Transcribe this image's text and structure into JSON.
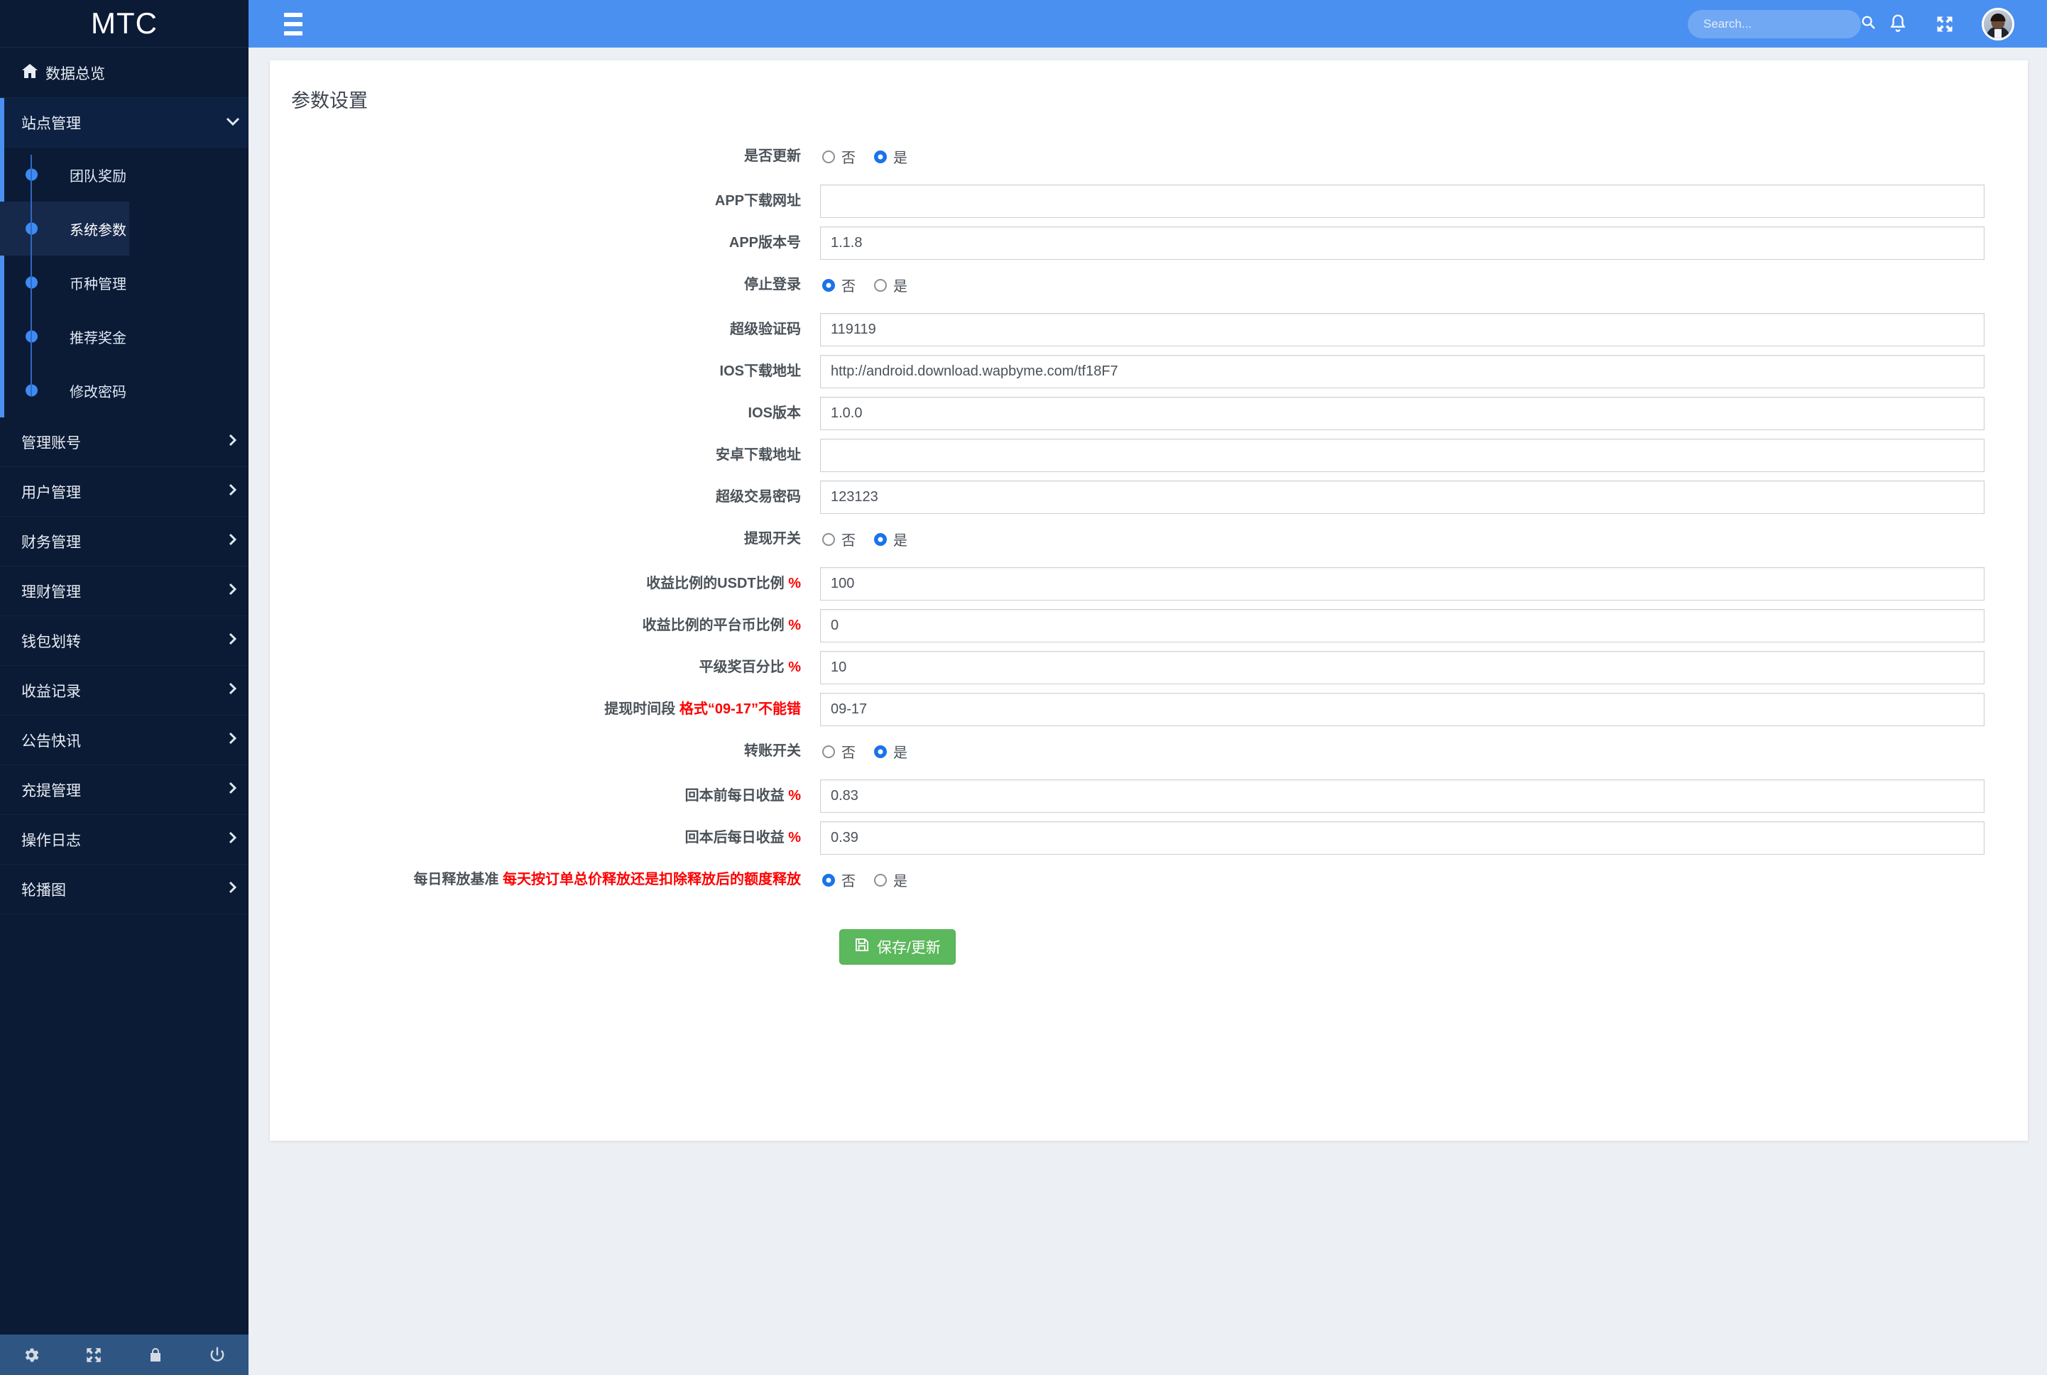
{
  "brand": {
    "title": "MTC"
  },
  "header": {
    "search": {
      "placeholder": "Search...",
      "value": ""
    },
    "icons": {
      "menu": "hamburger-icon",
      "search": "search-icon",
      "bell": "bell-icon",
      "fullscreen": "fullscreen-icon",
      "avatar": "user-avatar"
    }
  },
  "sidebar": {
    "home": {
      "label": "数据总览",
      "icon": "home-icon"
    },
    "group": {
      "label": "站点管理",
      "chevron": "chevron-down-icon",
      "expanded": true
    },
    "subitems": [
      {
        "label": "团队奖励",
        "active": false
      },
      {
        "label": "系统参数",
        "active": true
      },
      {
        "label": "币种管理",
        "active": false
      },
      {
        "label": "推荐奖金",
        "active": false
      },
      {
        "label": "修改密码",
        "active": false
      }
    ],
    "items": [
      {
        "label": "管理账号",
        "chevron": "chevron-right-icon"
      },
      {
        "label": "用户管理",
        "chevron": "chevron-right-icon"
      },
      {
        "label": "财务管理",
        "chevron": "chevron-right-icon"
      },
      {
        "label": "理财管理",
        "chevron": "chevron-right-icon"
      },
      {
        "label": "钱包划转",
        "chevron": "chevron-right-icon"
      },
      {
        "label": "收益记录",
        "chevron": "chevron-right-icon"
      },
      {
        "label": "公告快讯",
        "chevron": "chevron-right-icon"
      },
      {
        "label": "充提管理",
        "chevron": "chevron-right-icon"
      },
      {
        "label": "操作日志",
        "chevron": "chevron-right-icon"
      },
      {
        "label": "轮播图",
        "chevron": "chevron-right-icon"
      }
    ],
    "footer_icons": [
      {
        "name": "gear-icon"
      },
      {
        "name": "fullscreen-icon"
      },
      {
        "name": "lock-icon"
      },
      {
        "name": "power-icon"
      }
    ]
  },
  "page": {
    "title": "参数设置",
    "radio_labels": {
      "no": "否",
      "yes": "是"
    },
    "rows": [
      {
        "type": "radio",
        "label": "是否更新",
        "selected": "yes"
      },
      {
        "type": "text",
        "label": "APP下载网址",
        "value": ""
      },
      {
        "type": "text",
        "label": "APP版本号",
        "value": "1.1.8"
      },
      {
        "type": "radio",
        "label": "停止登录",
        "selected": "no"
      },
      {
        "type": "text",
        "label": "超级验证码",
        "value": "119119"
      },
      {
        "type": "text",
        "label": "IOS下载地址",
        "value": "http://android.download.wapbyme.com/tf18F7"
      },
      {
        "type": "text",
        "label": "IOS版本",
        "value": "1.0.0"
      },
      {
        "type": "text",
        "label": "安卓下载地址",
        "value": ""
      },
      {
        "type": "text",
        "label": "超级交易密码",
        "value": "123123"
      },
      {
        "type": "radio",
        "label": "提现开关",
        "selected": "yes"
      },
      {
        "type": "text",
        "label": "收益比例的USDT比例",
        "suffix": "%",
        "value": "100"
      },
      {
        "type": "text",
        "label": "收益比例的平台币比例",
        "suffix": "%",
        "value": "0"
      },
      {
        "type": "text",
        "label": "平级奖百分比",
        "suffix": "%",
        "value": "10"
      },
      {
        "type": "text",
        "label": "提现时间段",
        "hint": "格式“09-17”不能错",
        "value": "09-17"
      },
      {
        "type": "radio",
        "label": "转账开关",
        "selected": "yes"
      },
      {
        "type": "text",
        "label": "回本前每日收益",
        "suffix": "%",
        "value": "0.83"
      },
      {
        "type": "text",
        "label": "回本后每日收益",
        "suffix": "%",
        "value": "0.39"
      },
      {
        "type": "radio",
        "label": "每日释放基准",
        "hint": "每天按订单总价释放还是扣除释放后的额度释放",
        "selected": "no"
      }
    ],
    "save_label": "保存/更新",
    "save_icon": "save-icon"
  },
  "colors": {
    "header_blue": "#4a90f0",
    "sidebar_navy": "#0b1b35",
    "accent_blue": "#4a90f0",
    "radio_blue": "#1a73e8",
    "save_green": "#5cb85c",
    "hint_red": "#ff0000",
    "page_bg": "#eceff3"
  }
}
